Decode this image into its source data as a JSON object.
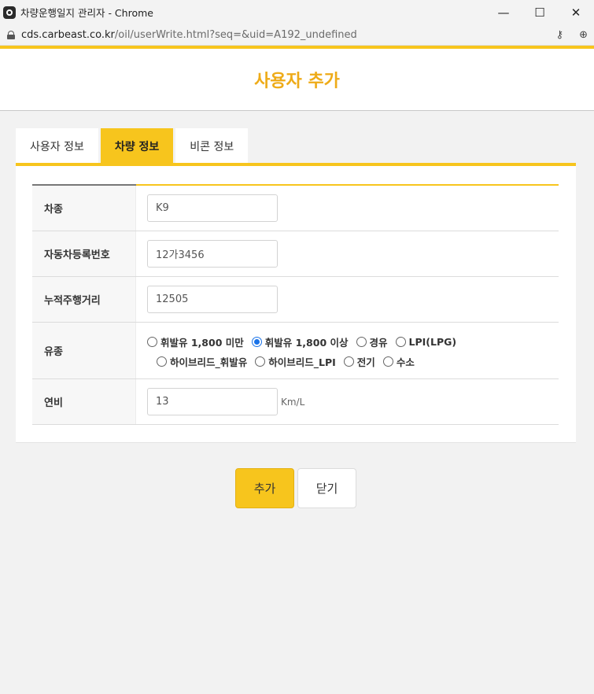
{
  "window": {
    "title": "차량운행일지 관리자 - Chrome",
    "controls": {
      "minimize": "—",
      "maximize": "☐",
      "close": "✕"
    }
  },
  "address": {
    "host": "cds.carbeast.co.kr",
    "path": "/oil/userWrite.html?seq=&uid=A192_undefined",
    "key_icon": "key-icon",
    "zoom_icon": "zoom-icon"
  },
  "page": {
    "title": "사용자 추가"
  },
  "tabs": [
    {
      "label": "사용자 정보",
      "active": false
    },
    {
      "label": "차량 정보",
      "active": true
    },
    {
      "label": "비콘 정보",
      "active": false
    }
  ],
  "form": {
    "car_type": {
      "label": "차종",
      "value": "K9"
    },
    "plate": {
      "label": "자동차등록번호",
      "value": "12가3456"
    },
    "mileage": {
      "label": "누적주행거리",
      "value": "12505"
    },
    "fuel": {
      "label": "유종",
      "options": [
        {
          "label": "휘발유 1,800 미만",
          "checked": false
        },
        {
          "label": "휘발유 1,800 이상",
          "checked": true
        },
        {
          "label": "경유",
          "checked": false
        },
        {
          "label": "LPI(LPG)",
          "checked": false
        },
        {
          "label": "하이브리드_휘발유",
          "checked": false
        },
        {
          "label": "하이브리드_LPI",
          "checked": false
        },
        {
          "label": "전기",
          "checked": false
        },
        {
          "label": "수소",
          "checked": false
        }
      ]
    },
    "efficiency": {
      "label": "연비",
      "value": "13",
      "unit": "Km/L"
    }
  },
  "buttons": {
    "add": "추가",
    "close": "닫기"
  },
  "colors": {
    "accent": "#f7c51d",
    "title": "#eeab18",
    "radio_checked": "#1a73e8"
  }
}
